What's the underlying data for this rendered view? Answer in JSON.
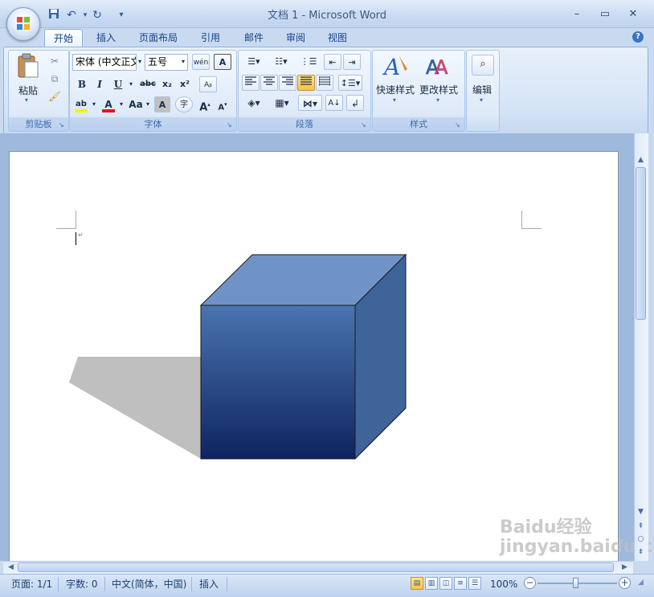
{
  "window": {
    "title": "文档 1 - Microsoft Word",
    "controls": {
      "minimize": "–",
      "maximize": "▭",
      "close": "✕"
    }
  },
  "quick_access": {
    "save_icon": "save-icon",
    "undo_icon": "undo-icon",
    "redo_icon": "redo-icon",
    "customize_icon": "customize-qat-icon"
  },
  "tabs": [
    {
      "label": "开始",
      "active": true
    },
    {
      "label": "插入"
    },
    {
      "label": "页面布局"
    },
    {
      "label": "引用"
    },
    {
      "label": "邮件"
    },
    {
      "label": "审阅"
    },
    {
      "label": "视图"
    }
  ],
  "help_glyph": "?",
  "ribbon": {
    "clipboard": {
      "label": "剪贴板",
      "paste_label": "粘贴"
    },
    "font": {
      "label": "字体",
      "font_name": "宋体 (中文正文)",
      "font_size": "五号",
      "phonetic_glyph": "wén",
      "char_border_glyph": "A",
      "bold": "B",
      "italic": "I",
      "underline": "U",
      "strike": "abc",
      "subscript": "x₂",
      "superscript": "x²",
      "clear_format_glyph": "Aᵦ",
      "highlight_glyph": "ab",
      "font_color_glyph": "A",
      "change_case_glyph": "Aa",
      "char_shading_glyph": "A",
      "enclose_glyph": "字",
      "grow_glyph": "A",
      "shrink_glyph": "A"
    },
    "paragraph": {
      "label": "段落"
    },
    "styles": {
      "label": "样式",
      "quick_styles": "快速样式",
      "change_styles": "更改样式"
    },
    "editing": {
      "label": "编辑"
    }
  },
  "colors": {
    "highlight": "#f5f500",
    "font_color": "#e01818",
    "cube_top": "#6f93c6",
    "cube_right": "#3e6499",
    "cube_front_top": "#4a74b0",
    "cube_front_bottom": "#0e2460",
    "shadow": "#bfbfbf"
  },
  "status": {
    "page": "页面: 1/1",
    "words": "字数: 0",
    "language": "中文(简体，中国)",
    "mode": "插入",
    "zoom": "100%"
  },
  "watermark": "Baidu经验 jingyan.baidu.com"
}
